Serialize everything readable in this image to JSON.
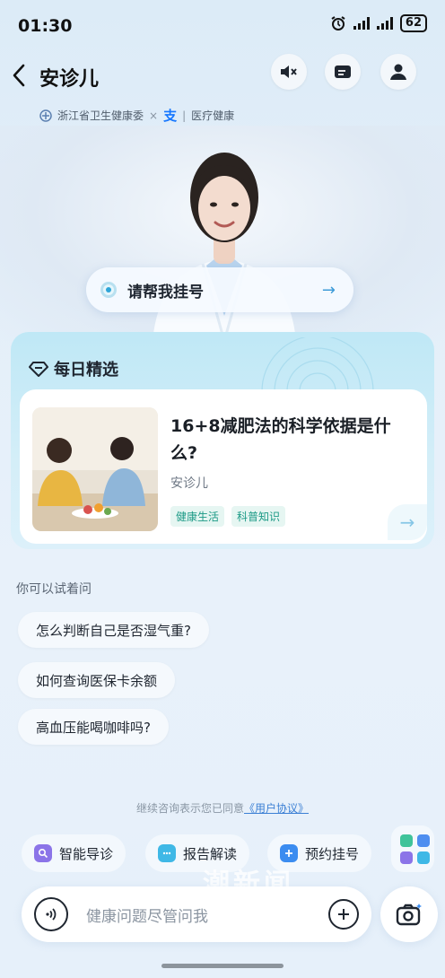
{
  "status": {
    "time": "01:30",
    "battery": "62"
  },
  "header": {
    "title": "安诊儿",
    "partner1": "浙江省卫生健康委",
    "separator": "×",
    "zhi": "支",
    "partner2": "医疗健康"
  },
  "ask": {
    "label": "请帮我挂号",
    "arrow": "→"
  },
  "daily": {
    "title": "每日精选",
    "article": {
      "title": "16+8减肥法的科学依据是什么?",
      "author": "安诊儿",
      "tags": [
        "健康生活",
        "科普知识"
      ],
      "arrow": "→"
    }
  },
  "suggestions": {
    "label": "你可以试着问",
    "items": [
      "怎么判断自己是否湿气重?",
      "如何查询医保卡余额",
      "高血压能喝咖啡吗?"
    ]
  },
  "agreement": {
    "text": "继续咨询表示您已同意",
    "link": "《用户协议》"
  },
  "quick_actions": [
    {
      "label": "智能导诊",
      "icon": "guide-icon",
      "color": "#8b74e8"
    },
    {
      "label": "报告解读",
      "icon": "report-icon",
      "color": "#3fb8e6"
    },
    {
      "label": "预约挂号",
      "icon": "appointment-icon",
      "color": "#3b8cf0"
    }
  ],
  "input": {
    "placeholder": "健康问题尽管问我"
  },
  "watermark": "潮新闻",
  "colors": {
    "accent": "#3d9bd8",
    "tag": "#1c9a86"
  }
}
